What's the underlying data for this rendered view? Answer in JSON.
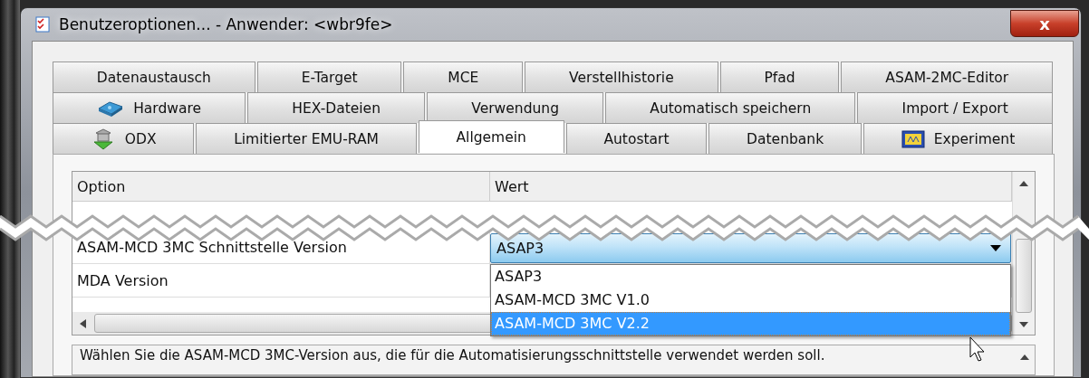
{
  "window": {
    "title": "Benutzeroptionen... - Anwender: <wbr9fe>",
    "close": "x"
  },
  "tab_rows": [
    [
      {
        "label": "Datenaustausch",
        "selected": false
      },
      {
        "label": "E-Target",
        "selected": false
      },
      {
        "label": "MCE",
        "selected": false
      },
      {
        "label": "Verstellhistorie",
        "selected": false
      },
      {
        "label": "Pfad",
        "selected": false
      },
      {
        "label": "ASAM-2MC-Editor",
        "selected": false
      }
    ],
    [
      {
        "label": "Hardware",
        "selected": false,
        "kind": "hardware"
      },
      {
        "label": "HEX-Dateien",
        "selected": false
      },
      {
        "label": "Verwendung",
        "selected": false
      },
      {
        "label": "Automatisch speichern",
        "selected": false
      },
      {
        "label": "Import / Export",
        "selected": false
      }
    ],
    [
      {
        "label": "ODX",
        "selected": false,
        "kind": "odx"
      },
      {
        "label": "Limitierter EMU-RAM",
        "selected": false
      },
      {
        "label": "Allgemein",
        "selected": true
      },
      {
        "label": "Autostart",
        "selected": false
      },
      {
        "label": "Datenbank",
        "selected": false
      },
      {
        "label": "Experiment",
        "selected": false,
        "kind": "experiment"
      }
    ]
  ],
  "table": {
    "columns": [
      "Option",
      "Wert"
    ],
    "rows": [
      {
        "option": "ASAM-MCD 3MC Schnittstelle Version",
        "value": "ASAP3",
        "kind": "dropdown"
      },
      {
        "option": "MDA Version",
        "kind": "text"
      }
    ]
  },
  "dropdown_list": [
    {
      "label": "ASAP3",
      "selected": false
    },
    {
      "label": "ASAM-MCD 3MC V1.0",
      "selected": false
    },
    {
      "label": "ASAM-MCD 3MC V2.2",
      "selected": true
    }
  ],
  "description": "Wählen Sie die ASAM-MCD 3MC-Version aus, die für die Automatisierungsschnittstelle verwendet werden soll."
}
